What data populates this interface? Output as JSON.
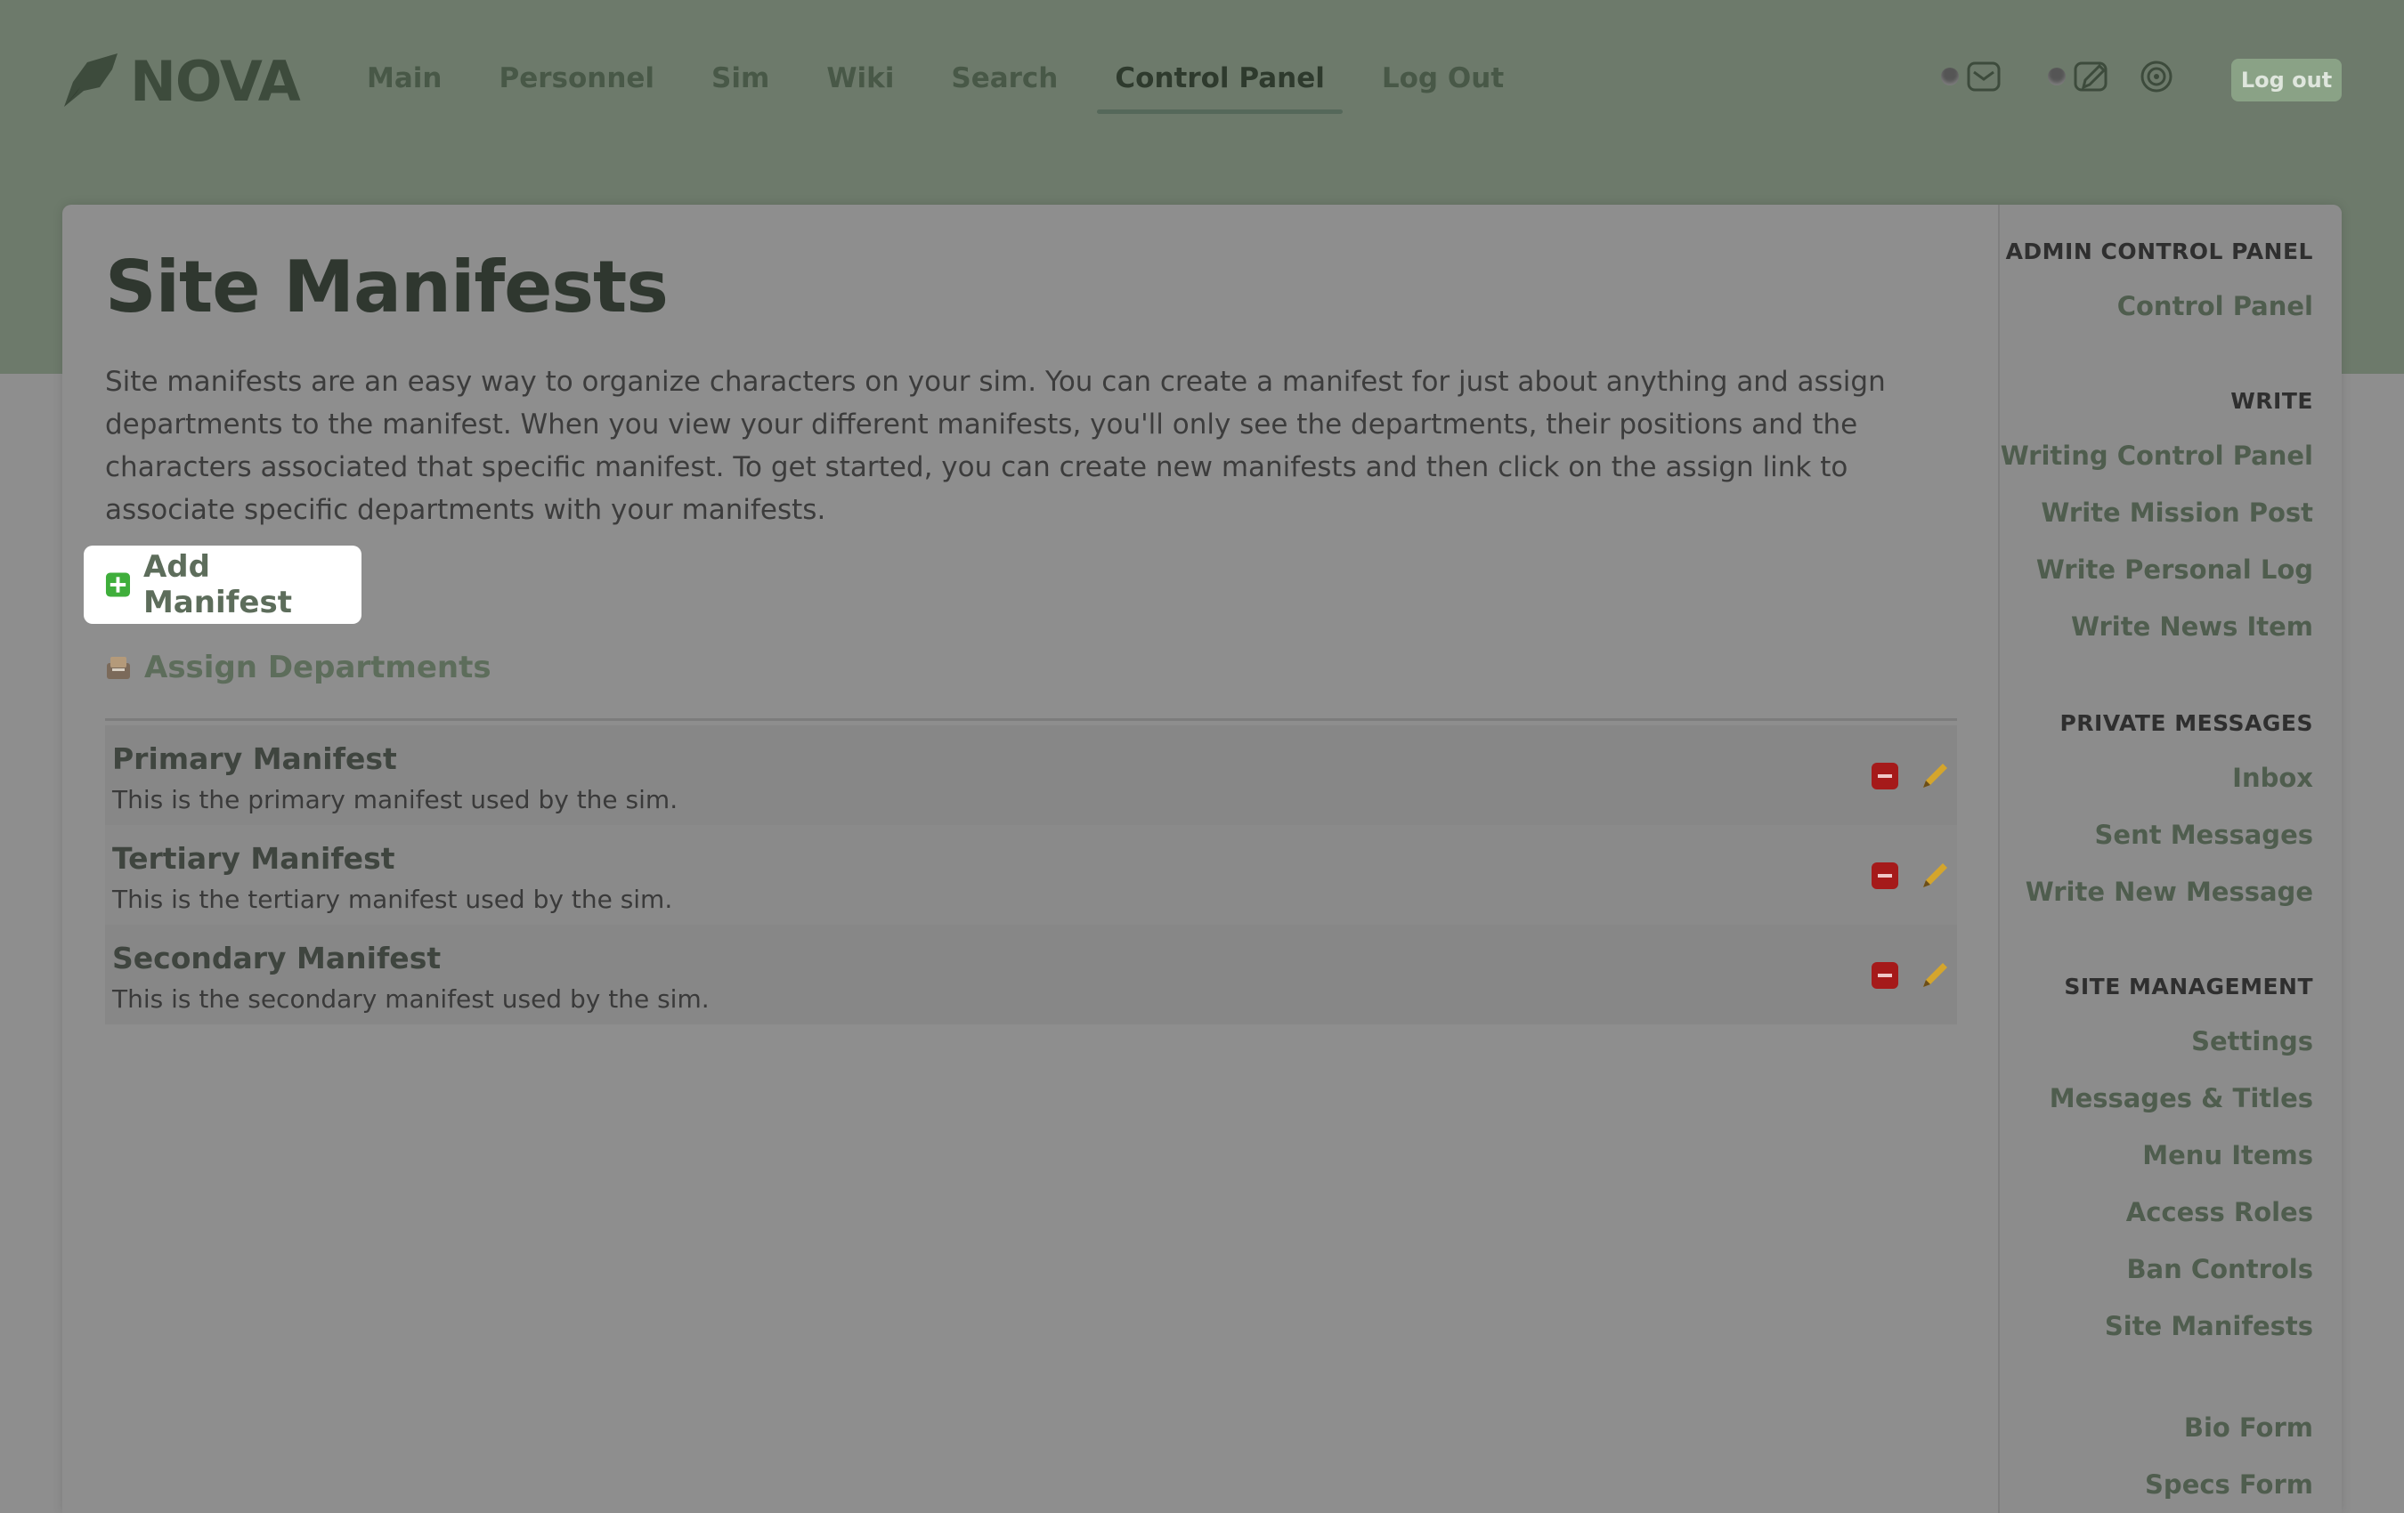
{
  "brand": {
    "logo_text": "NOVA"
  },
  "nav": {
    "items": [
      {
        "label": "Main"
      },
      {
        "label": "Personnel"
      },
      {
        "label": "Sim"
      },
      {
        "label": "Wiki"
      },
      {
        "label": "Search"
      },
      {
        "label": "Control Panel",
        "active": true
      },
      {
        "label": "Log Out"
      }
    ]
  },
  "header": {
    "logout_button": "Log out"
  },
  "page": {
    "title": "Site Manifests",
    "intro": "Site manifests are an easy way to organize characters on your sim. You can create a manifest for just about anything and assign departments to the manifest. When you view your different manifests, you'll only see the departments, their positions and the characters associated that specific manifest. To get started, you can create new manifests and then click on the assign link to associate specific departments with your manifests.",
    "add_manifest": "Add Manifest",
    "assign_departments": "Assign Departments"
  },
  "manifests": [
    {
      "name": "Primary Manifest",
      "description": "This is the primary manifest used by the sim."
    },
    {
      "name": "Tertiary Manifest",
      "description": "This is the tertiary manifest used by the sim."
    },
    {
      "name": "Secondary Manifest",
      "description": "This is the secondary manifest used by the sim."
    }
  ],
  "sidebar": {
    "admin": {
      "heading": "ADMIN CONTROL PANEL",
      "items": [
        "Control Panel"
      ]
    },
    "write": {
      "heading": "WRITE",
      "items": [
        "Writing Control Panel",
        "Write Mission Post",
        "Write Personal Log",
        "Write News Item"
      ]
    },
    "pm": {
      "heading": "PRIVATE MESSAGES",
      "items": [
        "Inbox",
        "Sent Messages",
        "Write New Message"
      ]
    },
    "site": {
      "heading": "SITE MANAGEMENT",
      "items": [
        "Settings",
        "Messages & Titles",
        "Menu Items",
        "Access Roles",
        "Ban Controls",
        "Site Manifests"
      ]
    },
    "forms": {
      "items": [
        "Bio Form",
        "Specs Form"
      ]
    }
  },
  "colors": {
    "header_bg": "#6d7a6b",
    "overlay_bg": "#8e8e8e",
    "accent_green": "#8aa286",
    "delete_red": "#a51a1a"
  }
}
